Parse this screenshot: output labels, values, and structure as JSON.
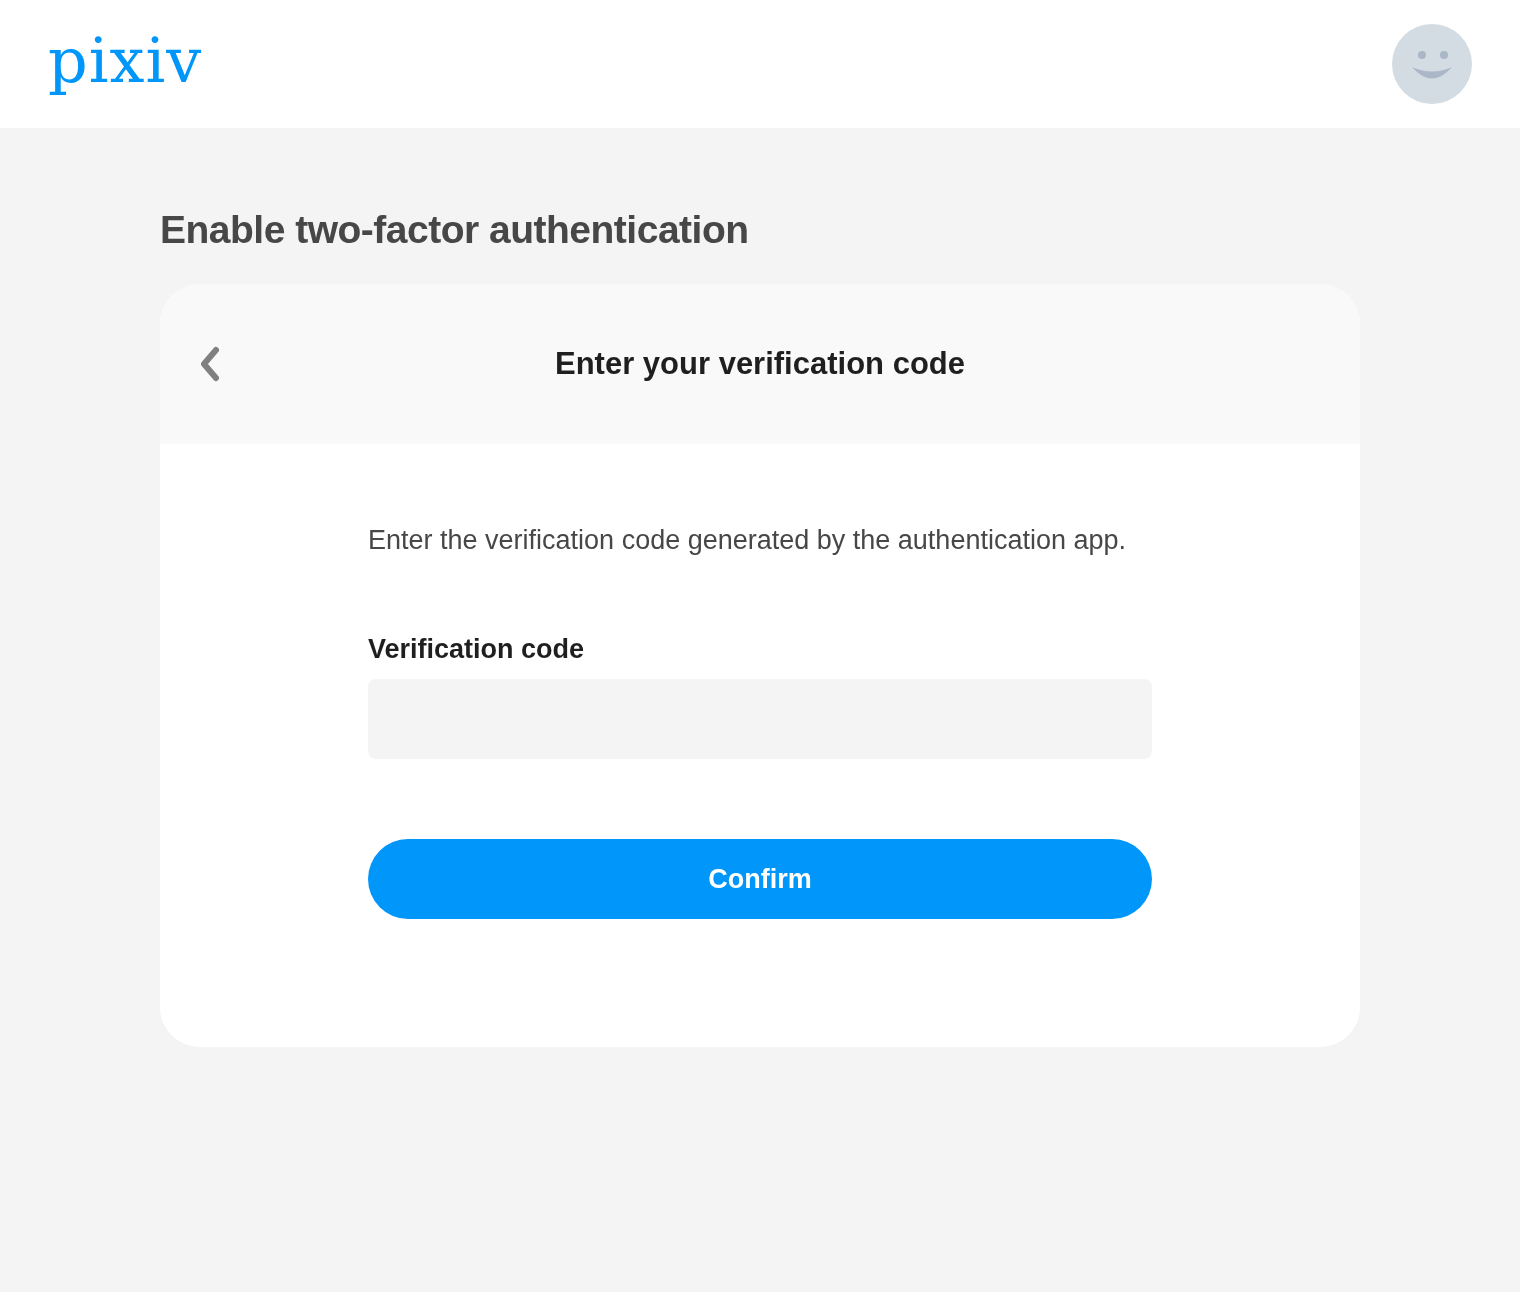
{
  "header": {
    "logo": "pixiv"
  },
  "page": {
    "title": "Enable two-factor authentication"
  },
  "card": {
    "title": "Enter your verification code",
    "description": "Enter the verification code generated by the authentication app.",
    "field": {
      "label": "Verification code"
    },
    "button": "Confirm"
  }
}
